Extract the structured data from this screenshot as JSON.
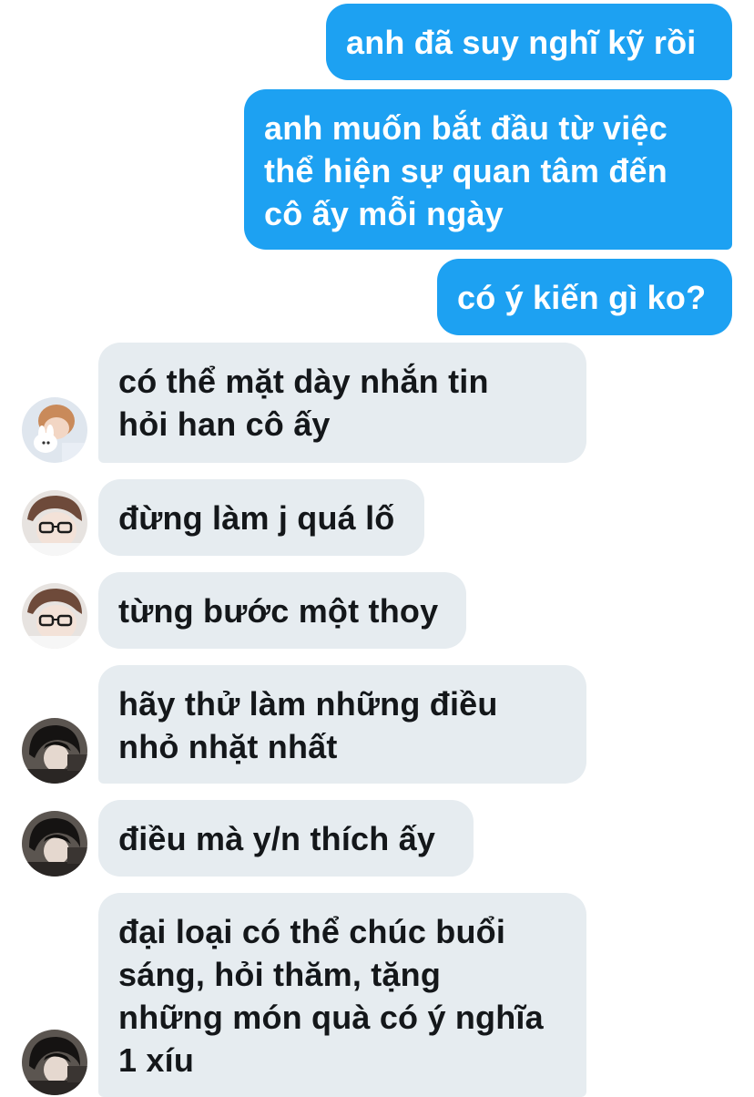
{
  "colors": {
    "outgoing_bubble": "#1da1f2",
    "incoming_bubble": "#e6ecf0",
    "outgoing_text": "#ffffff",
    "incoming_text": "#14171a"
  },
  "messages": [
    {
      "direction": "outgoing",
      "text": "anh đã suy nghĩ kỹ rồi"
    },
    {
      "direction": "outgoing",
      "text": "anh muốn bắt đầu từ việc\nthể hiện sự quan tâm đến\ncô ấy mỗi ngày"
    },
    {
      "direction": "outgoing",
      "text": "có ý kiến gì ko?"
    },
    {
      "direction": "incoming",
      "avatar": "avatar-boy-with-plush-bunny",
      "text": "có thể mặt dày nhắn tin\nhỏi han cô ấy"
    },
    {
      "direction": "incoming",
      "avatar": "avatar-boy-with-glasses",
      "text": "đừng làm j quá lố"
    },
    {
      "direction": "incoming",
      "avatar": "avatar-boy-with-glasses",
      "text": "từng bước một thoy"
    },
    {
      "direction": "incoming",
      "avatar": "avatar-dark-hair-boy",
      "text": "hãy thử làm những điều\nnhỏ nhặt nhất"
    },
    {
      "direction": "incoming",
      "avatar": "avatar-dark-hair-boy",
      "text": "điều mà y/n thích ấy"
    },
    {
      "direction": "incoming",
      "avatar": "avatar-dark-hair-boy",
      "text": "đại loại có thể chúc buổi\nsáng, hỏi thăm, tặng\nnhững món quà có ý nghĩa\n1 xíu"
    }
  ]
}
